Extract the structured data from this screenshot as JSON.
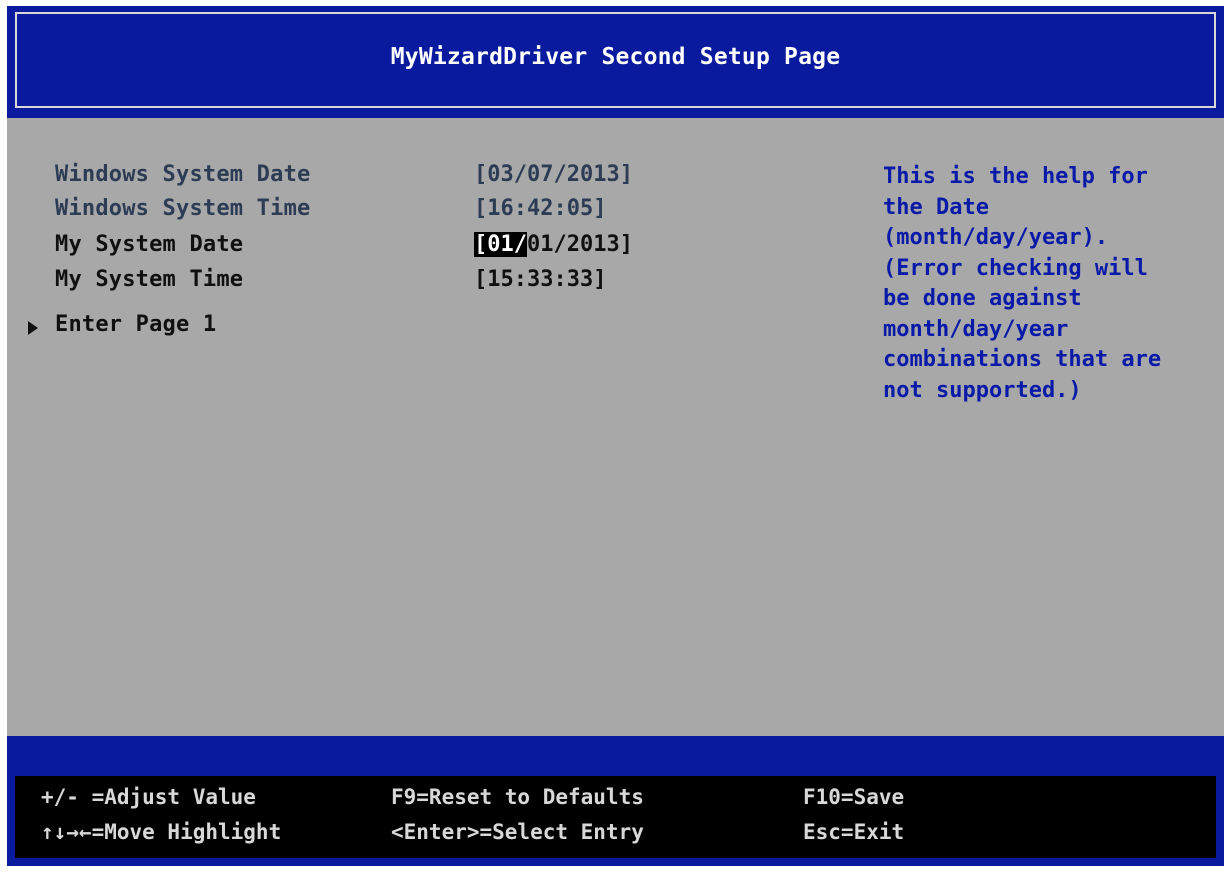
{
  "header": {
    "title": "MyWizardDriver Second Setup Page"
  },
  "menu": {
    "items": [
      {
        "label": "Windows System Date",
        "value": "[03/07/2013]"
      },
      {
        "label": "Windows System Time",
        "value": "[16:42:05]"
      },
      {
        "label": "My System Date",
        "value_highlight": "[01/",
        "value_rest": "01/2013]"
      },
      {
        "label": "My System Time",
        "value": "[15:33:33]"
      },
      {
        "label": "Enter Page 1"
      }
    ]
  },
  "help": {
    "lines": [
      "This is the help for",
      "the Date",
      "(month/day/year).",
      "(Error checking will",
      "be done against",
      "month/day/year",
      "combinations that are",
      "not supported.)"
    ]
  },
  "footer": {
    "adjust": "+/- =Adjust Value",
    "move": "↑↓→←=Move Highlight",
    "reset": "F9=Reset to Defaults",
    "select": "<Enter>=Select Entry",
    "save": "F10=Save",
    "exit": "Esc=Exit"
  },
  "colors": {
    "header_bg": "#0a1a9e",
    "body_bg": "#a8a8a8",
    "help_text": "#0a1aa8",
    "footer_bg": "#000000"
  }
}
